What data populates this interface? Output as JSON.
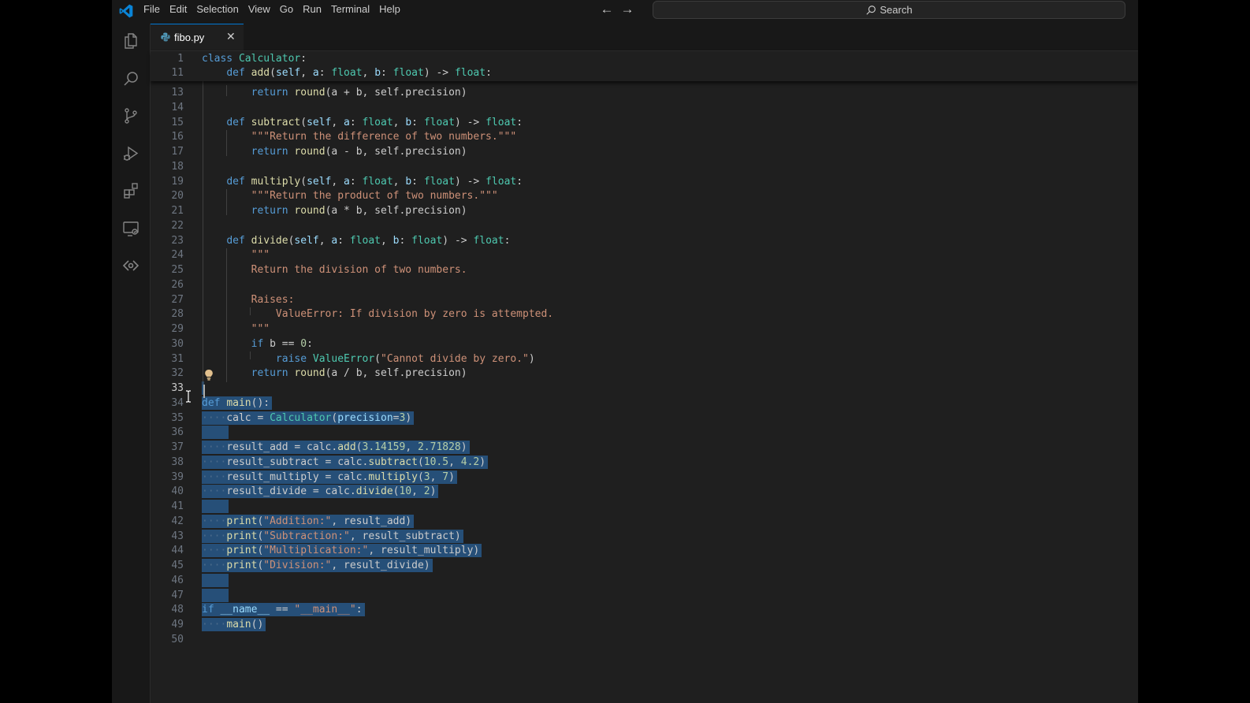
{
  "titlebar": {
    "menu": [
      "File",
      "Edit",
      "Selection",
      "View",
      "Go",
      "Run",
      "Terminal",
      "Help"
    ],
    "search_label": "Search",
    "icons": [
      "vscode-logo-icon",
      "arrow-left-icon",
      "arrow-right-icon",
      "search-icon"
    ]
  },
  "activity_bar": [
    "explorer-icon",
    "search-icon",
    "source-control-icon",
    "run-debug-icon",
    "extensions-icon",
    "remote-explorer-icon",
    "remote-connection-icon"
  ],
  "tab": {
    "name": "fibo.py",
    "close": "✕"
  },
  "editor": {
    "active_line": "33",
    "sticky": [
      {
        "num": "1",
        "segs": [
          {
            "t": "class ",
            "c": "kw"
          },
          {
            "t": "Calculator",
            "c": "cls"
          },
          {
            "t": ":",
            "c": ""
          }
        ]
      },
      {
        "num": "11",
        "segs": [
          {
            "t": "    ",
            "c": ""
          },
          {
            "t": "def ",
            "c": "kw"
          },
          {
            "t": "add",
            "c": "fn"
          },
          {
            "t": "(",
            "c": ""
          },
          {
            "t": "self",
            "c": "par"
          },
          {
            "t": ", ",
            "c": ""
          },
          {
            "t": "a",
            "c": "par"
          },
          {
            "t": ": ",
            "c": ""
          },
          {
            "t": "float",
            "c": "cls"
          },
          {
            "t": ", ",
            "c": ""
          },
          {
            "t": "b",
            "c": "par"
          },
          {
            "t": ": ",
            "c": ""
          },
          {
            "t": "float",
            "c": "cls"
          },
          {
            "t": ") -> ",
            "c": ""
          },
          {
            "t": "float",
            "c": "cls"
          },
          {
            "t": ":",
            "c": ""
          }
        ]
      }
    ],
    "lines": [
      {
        "num": "13",
        "segs": [
          {
            "t": "        ",
            "c": ""
          },
          {
            "t": "return ",
            "c": "kw"
          },
          {
            "t": "round",
            "c": "fn"
          },
          {
            "t": "(a + b, self.precision)",
            "c": ""
          }
        ]
      },
      {
        "num": "14",
        "segs": []
      },
      {
        "num": "15",
        "segs": [
          {
            "t": "    ",
            "c": ""
          },
          {
            "t": "def ",
            "c": "kw"
          },
          {
            "t": "subtract",
            "c": "fn"
          },
          {
            "t": "(",
            "c": ""
          },
          {
            "t": "self",
            "c": "par"
          },
          {
            "t": ", ",
            "c": ""
          },
          {
            "t": "a",
            "c": "par"
          },
          {
            "t": ": ",
            "c": ""
          },
          {
            "t": "float",
            "c": "cls"
          },
          {
            "t": ", ",
            "c": ""
          },
          {
            "t": "b",
            "c": "par"
          },
          {
            "t": ": ",
            "c": ""
          },
          {
            "t": "float",
            "c": "cls"
          },
          {
            "t": ") -> ",
            "c": ""
          },
          {
            "t": "float",
            "c": "cls"
          },
          {
            "t": ":",
            "c": ""
          }
        ]
      },
      {
        "num": "16",
        "segs": [
          {
            "t": "        ",
            "c": ""
          },
          {
            "t": "\"\"\"Return the difference of two numbers.\"\"\"",
            "c": "str"
          }
        ]
      },
      {
        "num": "17",
        "segs": [
          {
            "t": "        ",
            "c": ""
          },
          {
            "t": "return ",
            "c": "kw"
          },
          {
            "t": "round",
            "c": "fn"
          },
          {
            "t": "(a - b, self.precision)",
            "c": ""
          }
        ]
      },
      {
        "num": "18",
        "segs": []
      },
      {
        "num": "19",
        "segs": [
          {
            "t": "    ",
            "c": ""
          },
          {
            "t": "def ",
            "c": "kw"
          },
          {
            "t": "multiply",
            "c": "fn"
          },
          {
            "t": "(",
            "c": ""
          },
          {
            "t": "self",
            "c": "par"
          },
          {
            "t": ", ",
            "c": ""
          },
          {
            "t": "a",
            "c": "par"
          },
          {
            "t": ": ",
            "c": ""
          },
          {
            "t": "float",
            "c": "cls"
          },
          {
            "t": ", ",
            "c": ""
          },
          {
            "t": "b",
            "c": "par"
          },
          {
            "t": ": ",
            "c": ""
          },
          {
            "t": "float",
            "c": "cls"
          },
          {
            "t": ") -> ",
            "c": ""
          },
          {
            "t": "float",
            "c": "cls"
          },
          {
            "t": ":",
            "c": ""
          }
        ]
      },
      {
        "num": "20",
        "segs": [
          {
            "t": "        ",
            "c": ""
          },
          {
            "t": "\"\"\"Return the product of two numbers.\"\"\"",
            "c": "str"
          }
        ]
      },
      {
        "num": "21",
        "segs": [
          {
            "t": "        ",
            "c": ""
          },
          {
            "t": "return ",
            "c": "kw"
          },
          {
            "t": "round",
            "c": "fn"
          },
          {
            "t": "(a * b, self.precision)",
            "c": ""
          }
        ]
      },
      {
        "num": "22",
        "segs": []
      },
      {
        "num": "23",
        "segs": [
          {
            "t": "    ",
            "c": ""
          },
          {
            "t": "def ",
            "c": "kw"
          },
          {
            "t": "divide",
            "c": "fn"
          },
          {
            "t": "(",
            "c": ""
          },
          {
            "t": "self",
            "c": "par"
          },
          {
            "t": ", ",
            "c": ""
          },
          {
            "t": "a",
            "c": "par"
          },
          {
            "t": ": ",
            "c": ""
          },
          {
            "t": "float",
            "c": "cls"
          },
          {
            "t": ", ",
            "c": ""
          },
          {
            "t": "b",
            "c": "par"
          },
          {
            "t": ": ",
            "c": ""
          },
          {
            "t": "float",
            "c": "cls"
          },
          {
            "t": ") -> ",
            "c": ""
          },
          {
            "t": "float",
            "c": "cls"
          },
          {
            "t": ":",
            "c": ""
          }
        ]
      },
      {
        "num": "24",
        "segs": [
          {
            "t": "        ",
            "c": ""
          },
          {
            "t": "\"\"\"",
            "c": "str"
          }
        ]
      },
      {
        "num": "25",
        "segs": [
          {
            "t": "        ",
            "c": ""
          },
          {
            "t": "Return the division of two numbers.",
            "c": "str"
          }
        ]
      },
      {
        "num": "26",
        "segs": []
      },
      {
        "num": "27",
        "segs": [
          {
            "t": "        ",
            "c": ""
          },
          {
            "t": "Raises:",
            "c": "str"
          }
        ]
      },
      {
        "num": "28",
        "segs": [
          {
            "t": "            ",
            "c": ""
          },
          {
            "t": "ValueError: If division by zero is attempted.",
            "c": "str"
          }
        ]
      },
      {
        "num": "29",
        "segs": [
          {
            "t": "        ",
            "c": ""
          },
          {
            "t": "\"\"\"",
            "c": "str"
          }
        ]
      },
      {
        "num": "30",
        "segs": [
          {
            "t": "        ",
            "c": ""
          },
          {
            "t": "if ",
            "c": "kw"
          },
          {
            "t": "b == ",
            "c": ""
          },
          {
            "t": "0",
            "c": "num"
          },
          {
            "t": ":",
            "c": ""
          }
        ]
      },
      {
        "num": "31",
        "segs": [
          {
            "t": "            ",
            "c": ""
          },
          {
            "t": "raise ",
            "c": "kw"
          },
          {
            "t": "ValueError",
            "c": "cls"
          },
          {
            "t": "(",
            "c": ""
          },
          {
            "t": "\"Cannot divide by zero.\"",
            "c": "str"
          },
          {
            "t": ")",
            "c": ""
          }
        ]
      },
      {
        "num": "32",
        "segs": [
          {
            "t": "        ",
            "c": ""
          },
          {
            "t": "return ",
            "c": "kw"
          },
          {
            "t": "round",
            "c": "fn"
          },
          {
            "t": "(a / b, self.precision)",
            "c": ""
          }
        ]
      },
      {
        "num": "33",
        "segs": [],
        "sel": true
      },
      {
        "num": "34",
        "sel": true,
        "segs": [
          {
            "t": "def ",
            "c": "kw"
          },
          {
            "t": "main",
            "c": "fn"
          },
          {
            "t": "():",
            "c": ""
          }
        ]
      },
      {
        "num": "35",
        "sel": true,
        "segs": [
          {
            "t": "····",
            "c": "ws"
          },
          {
            "t": "calc = ",
            "c": ""
          },
          {
            "t": "Calculator",
            "c": "cls"
          },
          {
            "t": "(",
            "c": ""
          },
          {
            "t": "precision",
            "c": "par"
          },
          {
            "t": "=",
            "c": ""
          },
          {
            "t": "3",
            "c": "num"
          },
          {
            "t": ")",
            "c": ""
          }
        ]
      },
      {
        "num": "36",
        "sel": true,
        "segs": [
          {
            "t": "    ",
            "c": ""
          }
        ]
      },
      {
        "num": "37",
        "sel": true,
        "segs": [
          {
            "t": "····",
            "c": "ws"
          },
          {
            "t": "result_add = calc.",
            "c": ""
          },
          {
            "t": "add",
            "c": "fn"
          },
          {
            "t": "(",
            "c": ""
          },
          {
            "t": "3.14159",
            "c": "num"
          },
          {
            "t": ", ",
            "c": ""
          },
          {
            "t": "2.71828",
            "c": "num"
          },
          {
            "t": ")",
            "c": ""
          }
        ]
      },
      {
        "num": "38",
        "sel": true,
        "segs": [
          {
            "t": "····",
            "c": "ws"
          },
          {
            "t": "result_subtract = calc.",
            "c": ""
          },
          {
            "t": "subtract",
            "c": "fn"
          },
          {
            "t": "(",
            "c": ""
          },
          {
            "t": "10.5",
            "c": "num"
          },
          {
            "t": ", ",
            "c": ""
          },
          {
            "t": "4.2",
            "c": "num"
          },
          {
            "t": ")",
            "c": ""
          }
        ]
      },
      {
        "num": "39",
        "sel": true,
        "segs": [
          {
            "t": "····",
            "c": "ws"
          },
          {
            "t": "result_multiply = calc.",
            "c": ""
          },
          {
            "t": "multiply",
            "c": "fn"
          },
          {
            "t": "(",
            "c": ""
          },
          {
            "t": "3",
            "c": "num"
          },
          {
            "t": ", ",
            "c": ""
          },
          {
            "t": "7",
            "c": "num"
          },
          {
            "t": ")",
            "c": ""
          }
        ]
      },
      {
        "num": "40",
        "sel": true,
        "segs": [
          {
            "t": "····",
            "c": "ws"
          },
          {
            "t": "result_divide = calc.",
            "c": ""
          },
          {
            "t": "divide",
            "c": "fn"
          },
          {
            "t": "(",
            "c": ""
          },
          {
            "t": "10",
            "c": "num"
          },
          {
            "t": ", ",
            "c": ""
          },
          {
            "t": "2",
            "c": "num"
          },
          {
            "t": ")",
            "c": ""
          }
        ]
      },
      {
        "num": "41",
        "sel": true,
        "segs": [
          {
            "t": "    ",
            "c": ""
          }
        ]
      },
      {
        "num": "42",
        "sel": true,
        "segs": [
          {
            "t": "····",
            "c": "ws"
          },
          {
            "t": "print",
            "c": "fn"
          },
          {
            "t": "(",
            "c": ""
          },
          {
            "t": "\"Addition:\"",
            "c": "str"
          },
          {
            "t": ", result_add)",
            "c": ""
          }
        ]
      },
      {
        "num": "43",
        "sel": true,
        "segs": [
          {
            "t": "····",
            "c": "ws"
          },
          {
            "t": "print",
            "c": "fn"
          },
          {
            "t": "(",
            "c": ""
          },
          {
            "t": "\"Subtraction:\"",
            "c": "str"
          },
          {
            "t": ", result_subtract)",
            "c": ""
          }
        ]
      },
      {
        "num": "44",
        "sel": true,
        "segs": [
          {
            "t": "····",
            "c": "ws"
          },
          {
            "t": "print",
            "c": "fn"
          },
          {
            "t": "(",
            "c": ""
          },
          {
            "t": "\"Multiplication:\"",
            "c": "str"
          },
          {
            "t": ", result_multiply)",
            "c": ""
          }
        ]
      },
      {
        "num": "45",
        "sel": true,
        "segs": [
          {
            "t": "····",
            "c": "ws"
          },
          {
            "t": "print",
            "c": "fn"
          },
          {
            "t": "(",
            "c": ""
          },
          {
            "t": "\"Division:\"",
            "c": "str"
          },
          {
            "t": ", result_divide)",
            "c": ""
          }
        ]
      },
      {
        "num": "46",
        "sel": true,
        "segs": [
          {
            "t": "    ",
            "c": ""
          }
        ]
      },
      {
        "num": "47",
        "sel": true,
        "segs": [
          {
            "t": "    ",
            "c": ""
          }
        ]
      },
      {
        "num": "48",
        "sel": true,
        "segs": [
          {
            "t": "if ",
            "c": "kw"
          },
          {
            "t": "__name__",
            "c": "par"
          },
          {
            "t": " == ",
            "c": ""
          },
          {
            "t": "\"__main__\"",
            "c": "str"
          },
          {
            "t": ":",
            "c": ""
          }
        ]
      },
      {
        "num": "49",
        "sel": true,
        "segs": [
          {
            "t": "····",
            "c": "ws"
          },
          {
            "t": "main",
            "c": "fn"
          },
          {
            "t": "()",
            "c": ""
          }
        ]
      },
      {
        "num": "50",
        "segs": []
      }
    ]
  }
}
